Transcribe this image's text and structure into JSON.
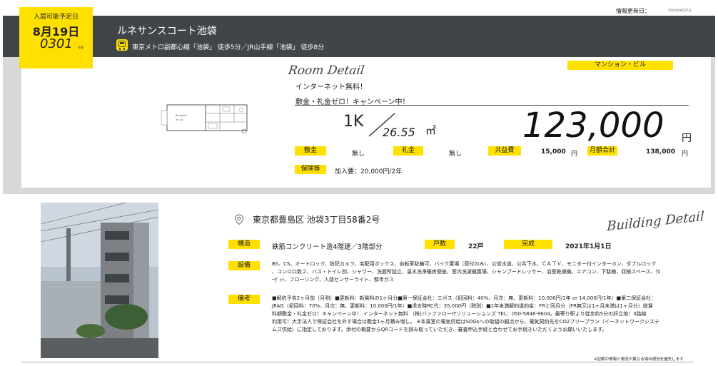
{
  "update": {
    "label": "情報更新日：",
    "date": "2023年06月27日"
  },
  "badge": {
    "label": "入居可能予定日",
    "date": "8月19日",
    "room": "0301",
    "room_suffix": "号室"
  },
  "building": {
    "title": "ルネサンスコート池袋",
    "access": "東京メトロ副都心線「池袋」 徒歩5分／JR山手線「池袋」 徒歩8分",
    "type": "マンション・ビル"
  },
  "room": {
    "section_title": "Room Detail",
    "features": [
      "インターネット無料！",
      "敷金・礼金ゼロ！キャンペーン中！"
    ],
    "layout": "1K",
    "area": "26.55",
    "area_unit": "㎡",
    "rent": "123,000",
    "rent_unit": "円",
    "fees": {
      "deposit_label": "敷金",
      "deposit_value": "無し",
      "key_money_label": "礼金",
      "key_money_value": "無し",
      "common_label": "共益費",
      "common_value": "15,000",
      "common_unit": "円",
      "total_label": "月額合計",
      "total_value": "138,000",
      "total_unit": "円"
    },
    "insurance_label": "保険等",
    "insurance_value": "加入要：20,000円/2年",
    "floorplan_label": "Bedroom"
  },
  "detail": {
    "section_title": "Building Detail",
    "address": "東京都豊島区 池袋3丁目58番2号",
    "structure_label": "構造",
    "structure_value": "鉄筋コンクリート造4階建／3階部分",
    "units_label": "戸数",
    "units_value": "22戸",
    "completed_label": "完成",
    "completed_value": "2021年1月1日",
    "equipment_label": "設備",
    "equipment_lines": [
      "BS、CS、オートロック、防犯カメラ、宅配用ボックス、自転車駐輪可、バイク置場（原付のみ）、公営水道、公共下水、ＣＡＴＶ、モニター付インターホン、ダブルロック",
      "、コンロ口数２、バス・トイレ別、シャワー、洗面所独立、温水洗浄暖房便座、室内洗濯機置場、シャンプードレッサー、浴室乾燥機、エアコン、下駄箱、収納スペース、ｸﾛ",
      "ｰｾﾞｯﾄ、フローリング、人感センサーライト、都市ガス"
    ],
    "remarks_label": "備考",
    "remarks_lines": [
      "■解約予告2ヶ月前（月割）■更新料：新賃料の1ヶ月分■第一保証会社：エポス（初回料：40%、月次：無、更新料：10,000円/1年 or 14,000円/1年）■第二保証会社：",
      "JRAG（初回料：70%、月次：無、更新料：10,000円/1年）■退去時RC代：35,000円（税別）■1年未満解約違約金：FRと同月分（FR無又は1ヶ月未満は1ヶ月分）総賃",
      "料額敷金・礼金ゼロ！キャンペーン中！ インターネット無料 （株)バッファローITソリューションズ TEL：050-5846-9604。最寄り駅より徒歩約5分の好立地！3路線",
      "利用可！大手法人で保証会社を外す場合は敷金1ヶ月積み増し。 ※本賃室の電気供給はSDGsへの取組の観点から、電気契約先をCO2フリープラン（イーネットワークシステ",
      "ムズ供給）に指定しております。添付の概要からQRコードを読み取っていただき、審査申込手続と合わせてお手続きいただくようお願いいたします。"
    ],
    "footnote": "※記載の情報と現況が異なる場合現況を優先します"
  }
}
